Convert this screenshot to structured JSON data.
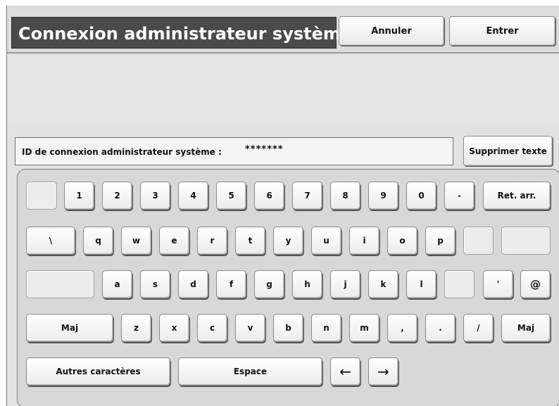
{
  "header": {
    "title": "Connexion administrateur système",
    "cancel_label": "Annuler",
    "enter_label": "Entrer"
  },
  "login": {
    "field_label": "ID de connexion administrateur système :",
    "field_value": "*******",
    "clear_label": "Supprimer texte"
  },
  "keyboard": {
    "row1": [
      "1",
      "2",
      "3",
      "4",
      "5",
      "6",
      "7",
      "8",
      "9",
      "0",
      "-"
    ],
    "backspace_label": "Ret. arr.",
    "row2": [
      "\\",
      "q",
      "w",
      "e",
      "r",
      "t",
      "y",
      "u",
      "i",
      "o",
      "p"
    ],
    "row3": [
      "a",
      "s",
      "d",
      "f",
      "g",
      "h",
      "j",
      "k",
      "l",
      "'",
      "@"
    ],
    "row4": [
      "z",
      "x",
      "c",
      "v",
      "b",
      "n",
      "m",
      ",",
      ".",
      "/"
    ],
    "shift_label": "Maj",
    "other_chars_label": "Autres caractères",
    "space_label": "Espace",
    "arrow_left": "←",
    "arrow_right": "→"
  }
}
